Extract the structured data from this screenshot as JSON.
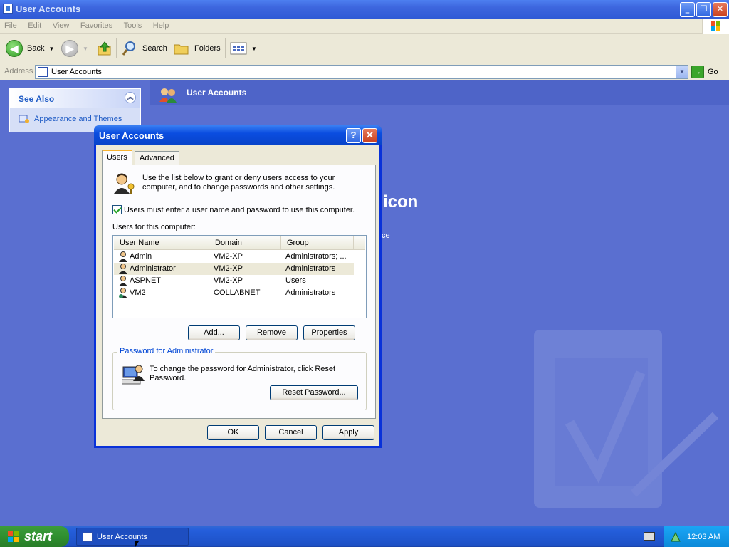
{
  "window": {
    "title": "User Accounts",
    "buttons": {
      "minimize": "_",
      "restore": "❐",
      "close": "✕"
    }
  },
  "menu": [
    "File",
    "Edit",
    "View",
    "Favorites",
    "Tools",
    "Help"
  ],
  "toolbar": {
    "back": "Back",
    "search": "Search",
    "folders": "Folders"
  },
  "address": {
    "label": "Address",
    "value": "User Accounts",
    "go": "Go"
  },
  "see_also": {
    "title": "See Also",
    "link": "Appearance and Themes"
  },
  "content": {
    "header_title": "User Accounts",
    "partial_heading": "icon",
    "partial_text": "ce"
  },
  "dialog": {
    "title": "User Accounts",
    "help_glyph": "?",
    "close_glyph": "✕",
    "tabs": [
      "Users",
      "Advanced"
    ],
    "intro": "Use the list below to grant or deny users access to your computer, and to change passwords and other settings.",
    "checkbox_label": "Users must enter a user name and password to use this computer.",
    "checkbox_checked": true,
    "list_label": "Users for this computer:",
    "columns": [
      "User Name",
      "Domain",
      "Group"
    ],
    "users": [
      {
        "name": "Admin",
        "domain": "VM2-XP",
        "group": "Administrators; ..."
      },
      {
        "name": "Administrator",
        "domain": "VM2-XP",
        "group": "Administrators"
      },
      {
        "name": "ASPNET",
        "domain": "VM2-XP",
        "group": "Users"
      },
      {
        "name": "VM2",
        "domain": "COLLABNET",
        "group": "Administrators"
      }
    ],
    "selected_user": "Administrator",
    "buttons": {
      "add": "Add...",
      "remove": "Remove",
      "properties": "Properties"
    },
    "password_group": {
      "title": "Password for Administrator",
      "text": "To change the password for Administrator, click Reset Password.",
      "reset": "Reset Password..."
    },
    "footer": {
      "ok": "OK",
      "cancel": "Cancel",
      "apply": "Apply"
    }
  },
  "taskbar": {
    "start": "start",
    "task": "User Accounts",
    "clock": "12:03 AM"
  },
  "colors": {
    "background": "#5a6fd0",
    "title_blue": "#0a4de0",
    "start_green": "#2f8f2f",
    "link_blue": "#215dc6"
  }
}
